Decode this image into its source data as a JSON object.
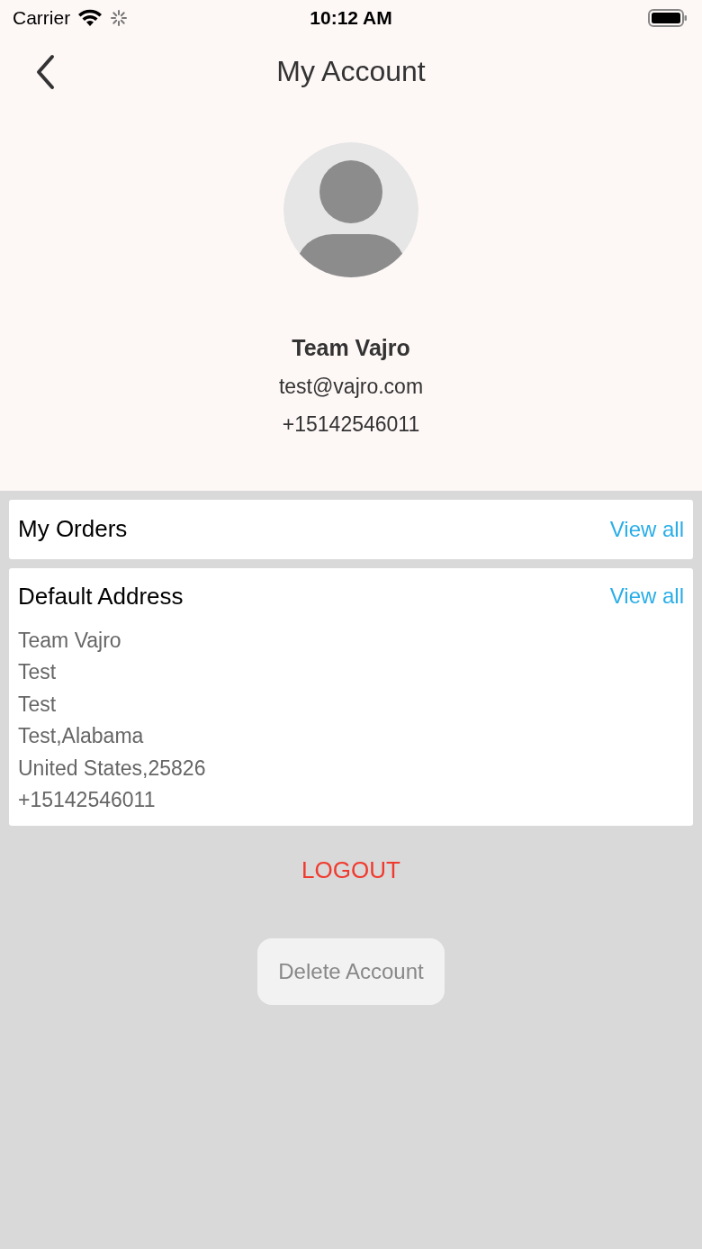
{
  "status_bar": {
    "carrier": "Carrier",
    "time": "10:12 AM"
  },
  "header": {
    "title": "My Account"
  },
  "profile": {
    "name": "Team Vajro",
    "email": "test@vajro.com",
    "phone": "+15142546011"
  },
  "orders": {
    "title": "My Orders",
    "link": "View all"
  },
  "address": {
    "title": "Default Address",
    "link": "View all",
    "lines": [
      "Team Vajro",
      "Test",
      "Test",
      "Test,Alabama",
      "United States,25826",
      "+15142546011"
    ]
  },
  "logout": "LOGOUT",
  "delete_button": "Delete Account"
}
